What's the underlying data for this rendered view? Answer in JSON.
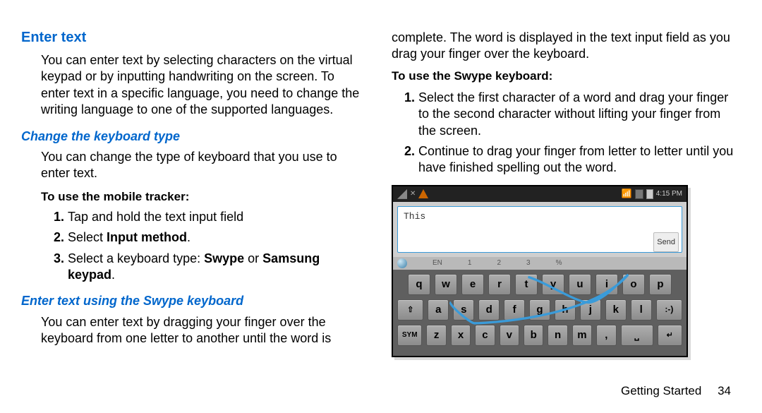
{
  "header": {
    "title": "Enter text"
  },
  "intro": "You can enter text by selecting characters on the virtual keypad or by inputting handwriting on the screen. To enter text in a specific language, you need to change the writing language to one of the supported languages.",
  "sections": {
    "change_kb": {
      "heading": "Change the keyboard type",
      "body": "You can change the type of keyboard that you use to enter text.",
      "sub": "To use the mobile tracker:",
      "steps": {
        "s1": "Tap and hold the text input field",
        "s2a": "Select ",
        "s2b": "Input method",
        "s2c": ".",
        "s3a": "Select a keyboard type: ",
        "s3b": "Swype",
        "s3c": " or ",
        "s3d": "Samsung keypad",
        "s3e": "."
      }
    },
    "swype_intro": {
      "heading": "Enter text using the Swype keyboard",
      "body_left": "You can enter text by dragging your finger over the keyboard from one letter to another until the word is",
      "body_right": "complete. The word is displayed in the text input field as you drag your finger over the keyboard.",
      "sub": "To use the Swype keyboard:",
      "steps": {
        "s1": "Select the first character of a word and drag your finger to the second character without lifting your finger from the screen.",
        "s2": "Continue to drag your finger from letter to letter until you have finished spelling out the word."
      }
    }
  },
  "phone": {
    "status": {
      "time": "4:15 PM"
    },
    "input_text": "This",
    "send_label": "Send",
    "top_labels": {
      "en": "EN",
      "n0": "1",
      "n1": "2",
      "n2": "3",
      "n3": "%"
    },
    "keys": {
      "r1": [
        "q",
        "w",
        "e",
        "r",
        "t",
        "y",
        "u",
        "i",
        "o",
        "p"
      ],
      "r2": [
        "a",
        "s",
        "d",
        "f",
        "g",
        "h",
        "j",
        "k",
        "l",
        ":-)"
      ],
      "r3": [
        "SYM",
        "z",
        "x",
        "c",
        "v",
        "b",
        "n",
        "m",
        ",",
        "␣",
        "⏎"
      ]
    }
  },
  "footer": {
    "section": "Getting Started",
    "page": "34"
  }
}
